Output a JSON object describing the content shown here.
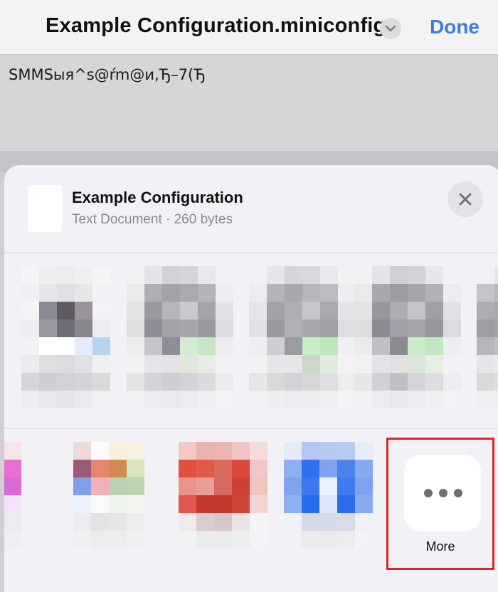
{
  "navbar": {
    "title": "Example Configuration.miniconfig",
    "done_label": "Done",
    "chevron_icon": "chevron-down-icon"
  },
  "document": {
    "content": "SMMSыя^s@ŕm@и,Ђ–7(Ђ"
  },
  "share_sheet": {
    "file_name": "Example Configuration",
    "file_meta": "Text Document · 260 bytes",
    "close_icon": "close-icon",
    "more_label": "More",
    "more_icon": "ellipsis-icon",
    "highlight_color": "#d9262a"
  }
}
